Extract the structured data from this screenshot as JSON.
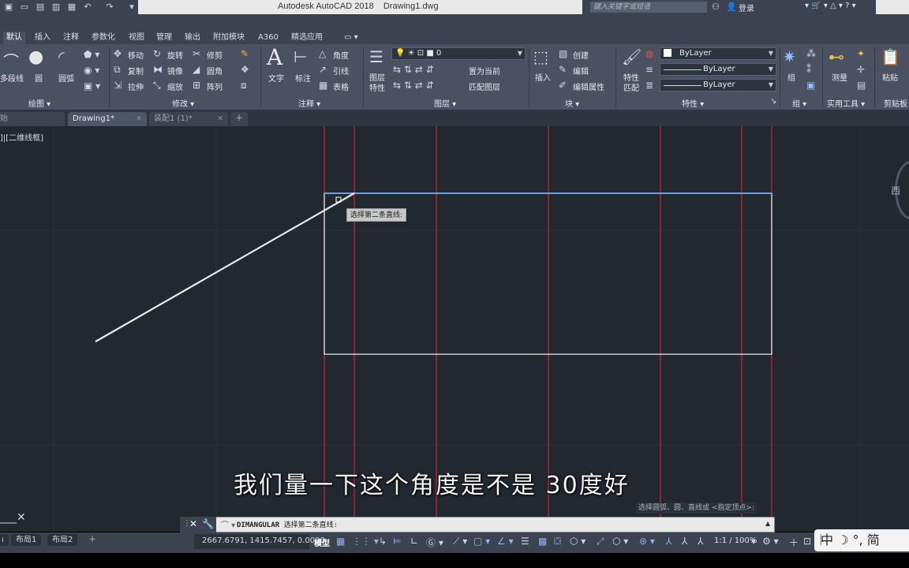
{
  "titlebar": {
    "app_title": "Autodesk AutoCAD 2018    Drawing1.dwg",
    "search_placeholder": "键入关键字或短语",
    "login_label": "登录"
  },
  "menu": {
    "tabs": [
      "默认",
      "插入",
      "注释",
      "参数化",
      "视图",
      "管理",
      "输出",
      "附加模块",
      "A360",
      "精选应用"
    ],
    "active_index": 0
  },
  "ribbon": {
    "draw": {
      "polyline": "多段线",
      "circle": "圆",
      "arc": "圆弧",
      "title": "绘图"
    },
    "modify": {
      "move": "移动",
      "rotate": "旋转",
      "trim": "修剪",
      "copy": "复制",
      "mirror": "镜像",
      "fillet": "圆角",
      "stretch": "拉伸",
      "scale": "缩放",
      "array": "阵列",
      "title": "修改"
    },
    "annotation": {
      "text": "文字",
      "dimension": "标注",
      "angle": "角度",
      "leader": "引线",
      "table": "表格",
      "title": "注释"
    },
    "layers": {
      "properties_line1": "图层",
      "properties_line2": "特性",
      "current_layer": "0",
      "set_current": "置为当前",
      "match_layer": "匹配图层",
      "title": "图层"
    },
    "block": {
      "insert": "插入",
      "create": "创建",
      "edit": "编辑",
      "edit_attributes": "编辑属性",
      "title": "块"
    },
    "properties": {
      "match_line1": "特性",
      "match_line2": "匹配",
      "color": "ByLayer",
      "linetype": "ByLayer",
      "lineweight": "ByLayer",
      "title": "特性"
    },
    "groups": {
      "group": "组",
      "title": "组"
    },
    "utilities": {
      "measure": "测量",
      "title": "实用工具"
    },
    "clipboard": {
      "paste": "粘贴",
      "title": "剪贴板"
    }
  },
  "file_tabs": [
    {
      "label": "始",
      "active": false
    },
    {
      "label": "Drawing1*",
      "active": true
    },
    {
      "label": "装配1 (1)*",
      "active": false
    }
  ],
  "canvas": {
    "viewport_label": "]|[二维线框]",
    "tooltip": "选择第二条直线:",
    "subtitle": "我们量一下这个角度是不是 30度好",
    "prompt_hint": "选择圆弧、圆、直线或 <指定顶点>:",
    "viewcube_direction": "西",
    "colors": {
      "background": "#212830",
      "red_line": "#c0262b",
      "blue_line": "#6f9fe0",
      "white_line": "#e8eaee"
    }
  },
  "command_line": {
    "command": "DIMANGULAR",
    "prompt": "选择第二条直线:"
  },
  "status": {
    "layout_tabs": [
      "布局1",
      "布局2"
    ],
    "coordinates": "2667.6791, 1415.7457, 0.0000",
    "model_label": "模型",
    "scale": "1:1 / 100%"
  },
  "ime": {
    "text": "中 ☽ °, 简"
  }
}
